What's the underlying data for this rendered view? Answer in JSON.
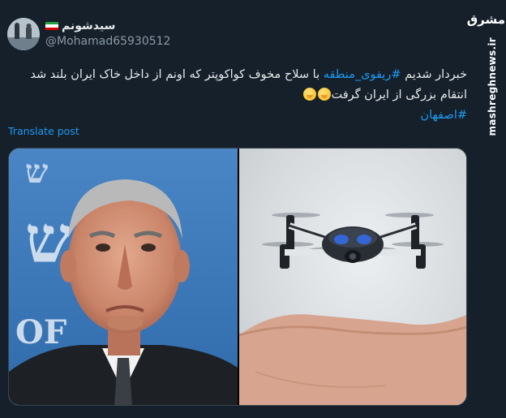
{
  "tweet": {
    "display_name": "سیدشونم",
    "handle": "@Mohamad65930512",
    "text": {
      "part1": "خبردار شدیم ",
      "hashtag1": "#ریفوی_منطقه",
      "part2": " با سلاح مخوف کواکوپتر که اونم از داخل خاک ایران بلند شد انتقام بزرگی از ایران گرفت",
      "hashtag2": "#اصفهان"
    },
    "emoji": "face-with-hand-over-mouth",
    "translate_label": "Translate post",
    "colors": {
      "background": "#15202b",
      "link": "#1d9bf0",
      "text": "#e7e9ea",
      "muted": "#8b98a5"
    }
  },
  "media": {
    "left_image": "man-frowning-portrait",
    "right_image": "quadcopter-drone-on-palm"
  },
  "watermark": {
    "logo": "مشرق",
    "site": "mashreghnews.ir"
  }
}
